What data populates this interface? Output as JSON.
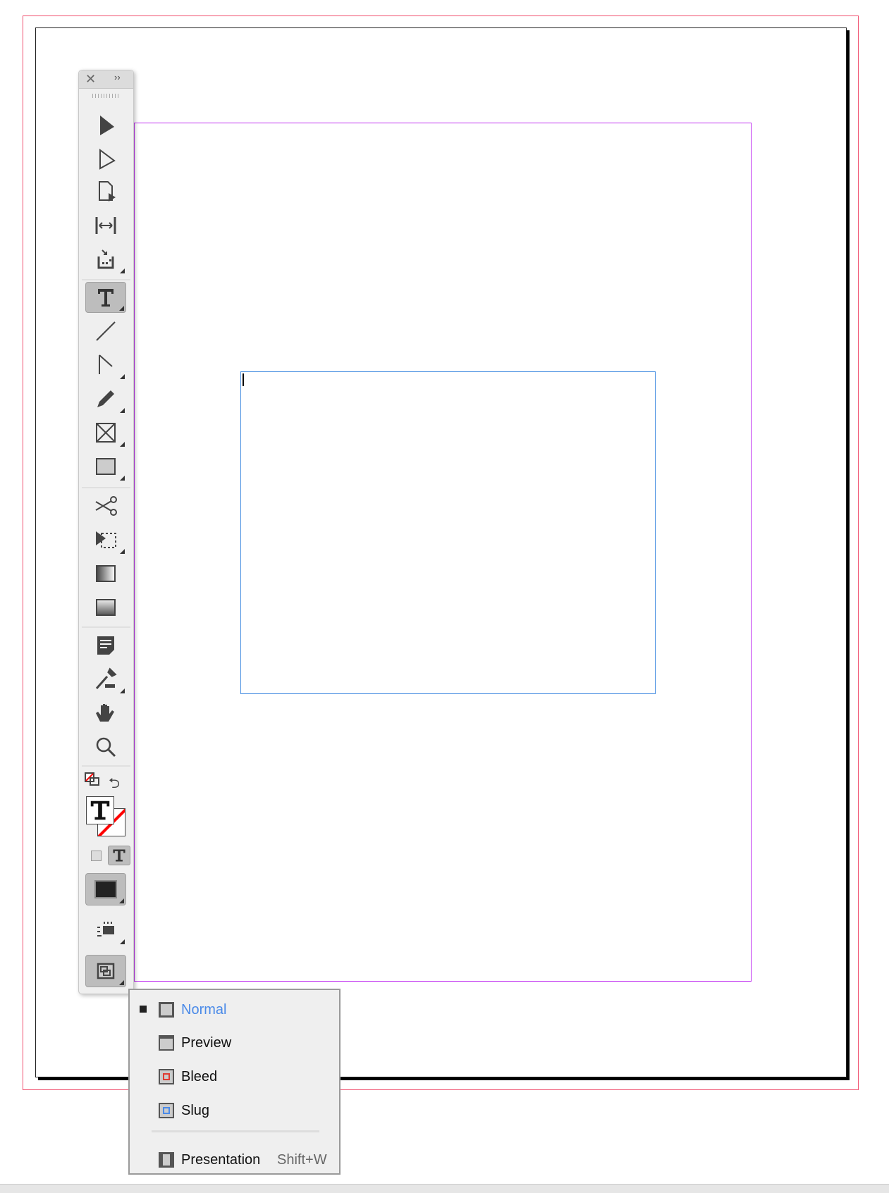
{
  "toolbar": {
    "tools": [
      "selection",
      "direct-selection",
      "page",
      "gap",
      "content-collector",
      "type",
      "line",
      "pen",
      "pencil",
      "rectangle-frame",
      "rectangle",
      "scissors",
      "free-transform",
      "gradient-swatch",
      "gradient-feather",
      "note",
      "eyedropper",
      "hand",
      "zoom"
    ],
    "selected_tool": "type"
  },
  "menu": {
    "items": [
      {
        "label": "Normal",
        "checked": true
      },
      {
        "label": "Preview"
      },
      {
        "label": "Bleed"
      },
      {
        "label": "Slug"
      },
      {
        "label": "Presentation",
        "shortcut": "Shift+W"
      }
    ]
  },
  "colors": {
    "bleed": "#f0506e",
    "margin": "#c030f0",
    "frame": "#4a90e2",
    "selected_menu": "#4a8ae8"
  }
}
